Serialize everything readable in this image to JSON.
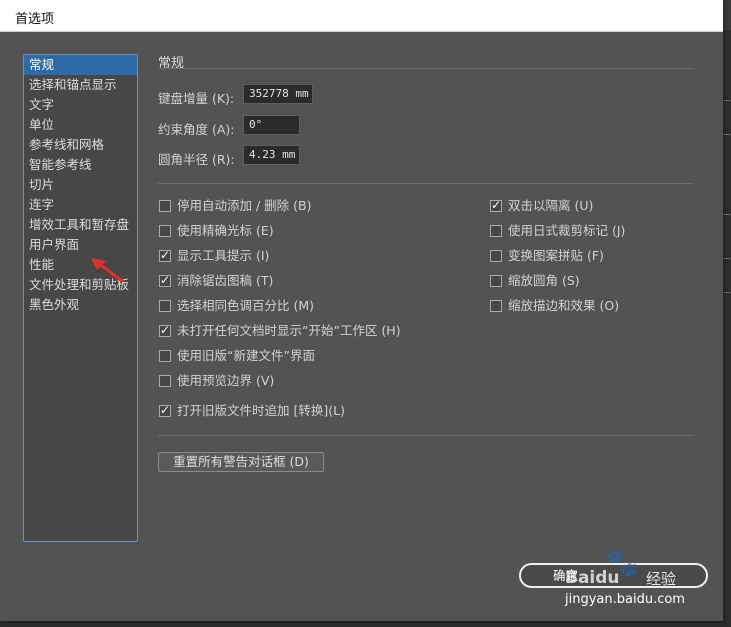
{
  "window": {
    "title": "首选项"
  },
  "sidebar": {
    "items": [
      {
        "label": "常规",
        "selected": true
      },
      {
        "label": "选择和锚点显示"
      },
      {
        "label": "文字"
      },
      {
        "label": "单位"
      },
      {
        "label": "参考线和网格"
      },
      {
        "label": "智能参考线"
      },
      {
        "label": "切片"
      },
      {
        "label": "连字"
      },
      {
        "label": "增效工具和暂存盘"
      },
      {
        "label": "用户界面"
      },
      {
        "label": "性能"
      },
      {
        "label": "文件处理和剪贴板"
      },
      {
        "label": "黑色外观"
      }
    ]
  },
  "main": {
    "section_title": "常规",
    "fields": [
      {
        "label": "键盘增量 (K):",
        "value": "352778 mm"
      },
      {
        "label": "约束角度 (A):",
        "value": "0°"
      },
      {
        "label": "圆角半径 (R):",
        "value": "4.23 mm"
      }
    ],
    "options_left": [
      {
        "label": "停用自动添加 / 删除 (B)",
        "checked": false
      },
      {
        "label": "使用精确光标 (E)",
        "checked": false
      },
      {
        "label": "显示工具提示 (I)",
        "checked": true
      },
      {
        "label": "消除锯齿图稿 (T)",
        "checked": true
      },
      {
        "label": "选择相同色调百分比 (M)",
        "checked": false
      },
      {
        "label": "未打开任何文档时显示“开始”工作区 (H)",
        "checked": true
      },
      {
        "label": "使用旧版“新建文件”界面",
        "checked": false
      },
      {
        "label": "使用预览边界 (V)",
        "checked": false
      },
      {
        "label": "打开旧版文件时追加 [转换](L)",
        "checked": true
      }
    ],
    "options_right": [
      {
        "label": "双击以隔离 (U)",
        "checked": true
      },
      {
        "label": "使用日式裁剪标记 (J)",
        "checked": false
      },
      {
        "label": "变换图案拼贴 (F)",
        "checked": false
      },
      {
        "label": "缩放圆角 (S)",
        "checked": false
      },
      {
        "label": "缩放描边和效果 (O)",
        "checked": false
      }
    ],
    "reset_button": "重置所有警告对话框 (D)"
  },
  "footer": {
    "ok_label": "确定"
  },
  "watermark": {
    "logo": "Baidu",
    "text": "经验",
    "url": "jingyan.baidu.com"
  },
  "colors": {
    "dialog_bg": "#535353",
    "selection": "#2f6aa8",
    "annotation_arrow": "#e0322c"
  }
}
